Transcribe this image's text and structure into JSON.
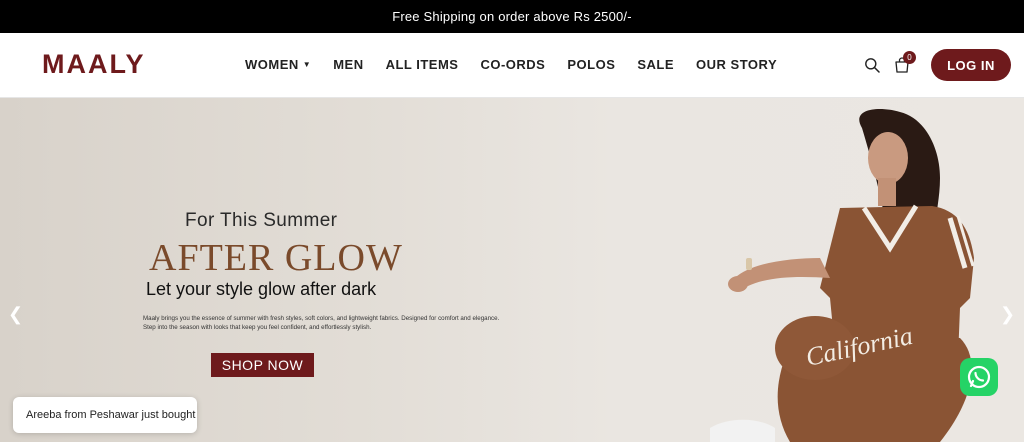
{
  "announcement": "Free Shipping on order above Rs 2500/-",
  "header": {
    "logo": "MAALY",
    "nav": [
      {
        "label": "WOMEN",
        "has_dropdown": true
      },
      {
        "label": "MEN"
      },
      {
        "label": "ALL ITEMS"
      },
      {
        "label": "CO-ORDS"
      },
      {
        "label": "POLOS"
      },
      {
        "label": "SALE"
      },
      {
        "label": "OUR STORY"
      }
    ],
    "cart_count": "0",
    "login_label": "LOG IN"
  },
  "hero": {
    "subtitle": "For This Summer",
    "title": "AFTER GLOW",
    "tagline": "Let your style glow after dark",
    "body": "Maaly brings you the essence of summer with fresh styles, soft colors, and lightweight fabrics. Designed for comfort and elegance. Step into the season with looks that keep you feel confident, and effortlessly stylish.",
    "cta": "SHOP NOW",
    "model_shirt_text": "California"
  },
  "toast": "Areeba from Peshawar just bought",
  "colors": {
    "brand": "#6e1a1c",
    "headline": "#7a4a2b",
    "whatsapp": "#25d366"
  },
  "icons": [
    "search-icon",
    "cart-icon",
    "chevron-left-icon",
    "chevron-right-icon",
    "whatsapp-icon",
    "chevron-down-icon"
  ]
}
